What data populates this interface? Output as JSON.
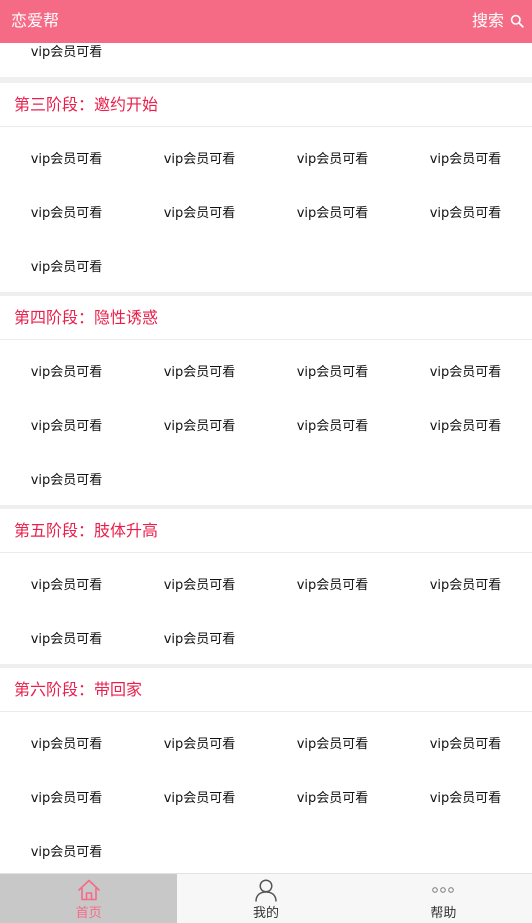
{
  "header": {
    "title": "恋爱帮",
    "search_label": "搜索"
  },
  "top_partial": {
    "items": [
      "vip会员可看"
    ]
  },
  "sections": [
    {
      "title": "第三阶段：邀约开始",
      "items": [
        "vip会员可看",
        "vip会员可看",
        "vip会员可看",
        "vip会员可看",
        "vip会员可看",
        "vip会员可看",
        "vip会员可看",
        "vip会员可看",
        "vip会员可看"
      ]
    },
    {
      "title": "第四阶段：隐性诱惑",
      "items": [
        "vip会员可看",
        "vip会员可看",
        "vip会员可看",
        "vip会员可看",
        "vip会员可看",
        "vip会员可看",
        "vip会员可看",
        "vip会员可看",
        "vip会员可看"
      ]
    },
    {
      "title": "第五阶段：肢体升高",
      "items": [
        "vip会员可看",
        "vip会员可看",
        "vip会员可看",
        "vip会员可看",
        "vip会员可看",
        "vip会员可看"
      ]
    },
    {
      "title": "第六阶段：带回家",
      "items": [
        "vip会员可看",
        "vip会员可看",
        "vip会员可看",
        "vip会员可看",
        "vip会员可看",
        "vip会员可看",
        "vip会员可看",
        "vip会员可看",
        "vip会员可看"
      ]
    }
  ],
  "tabbar": {
    "active_tab": "home",
    "tabs": [
      {
        "key": "home",
        "label": "首页",
        "icon": "home-icon"
      },
      {
        "key": "mine",
        "label": "我的",
        "icon": "user-icon"
      },
      {
        "key": "help",
        "label": "帮助",
        "icon": "more-icon"
      }
    ]
  },
  "colors": {
    "brand": "#f56b86",
    "section_title": "#ea1f4b"
  }
}
